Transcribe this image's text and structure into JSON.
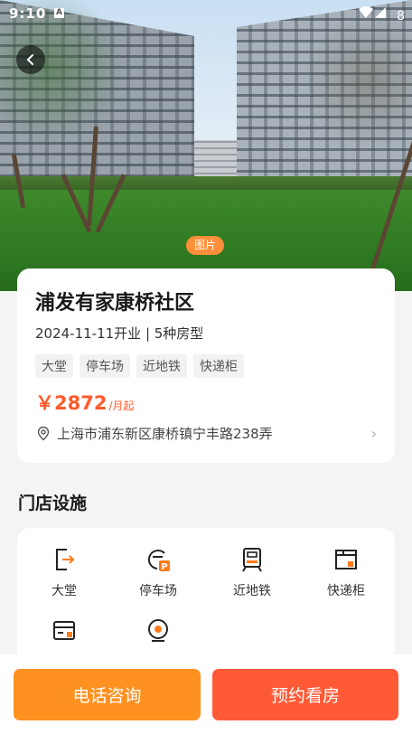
{
  "status_bar": {
    "time": "9:10",
    "indicator": "A",
    "battery": "8"
  },
  "hero": {
    "photo_tag": "图片"
  },
  "listing": {
    "title": "浦发有家康桥社区",
    "subtitle": "2024-11-11开业 | 5种房型",
    "tags": [
      "大堂",
      "停车场",
      "近地铁",
      "快递柜"
    ],
    "price_amount": "￥2872",
    "price_unit": "/月起",
    "address": "上海市浦东新区康桥镇宁丰路238弄"
  },
  "facilities": {
    "title": "门店设施",
    "items": [
      {
        "label": "大堂",
        "icon": "lobby-icon"
      },
      {
        "label": "停车场",
        "icon": "parking-icon"
      },
      {
        "label": "近地铁",
        "icon": "subway-icon"
      },
      {
        "label": "快递柜",
        "icon": "parcel-locker-icon"
      },
      {
        "label": "",
        "icon": "card-icon"
      },
      {
        "label": "",
        "icon": "camera-icon"
      }
    ]
  },
  "actions": {
    "call": "电话咨询",
    "book": "预约看房"
  },
  "colors": {
    "accent_orange": "#ff9121",
    "accent_red": "#ff5a36",
    "price": "#ff5a2c"
  }
}
